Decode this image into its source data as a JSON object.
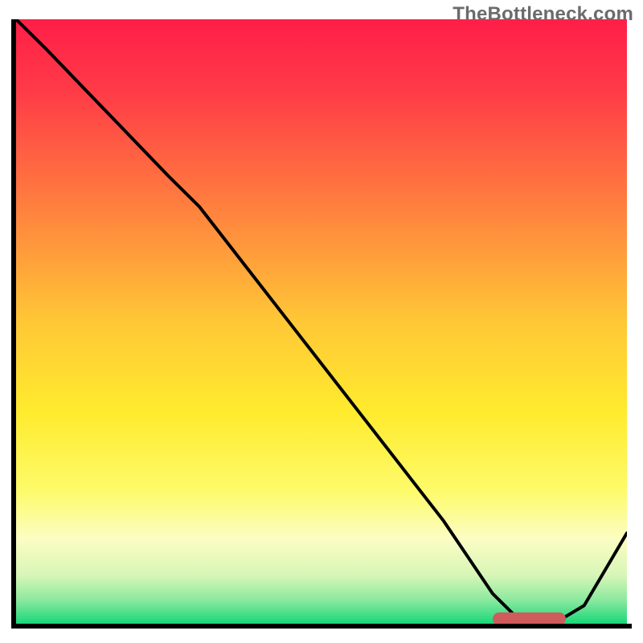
{
  "attribution": "TheBottleneck.com",
  "chart_data": {
    "type": "line",
    "title": "",
    "xlabel": "",
    "ylabel": "",
    "xlim": [
      0,
      100
    ],
    "ylim": [
      0,
      100
    ],
    "series": [
      {
        "name": "curve",
        "x": [
          0,
          5,
          25,
          30,
          40,
          50,
          60,
          70,
          78,
          82,
          88,
          93,
          100
        ],
        "values": [
          100,
          95,
          74,
          69,
          56,
          43,
          30,
          17,
          5,
          1,
          0,
          3,
          15
        ]
      }
    ],
    "marker": {
      "x_start": 78,
      "x_end": 90,
      "y": 0
    },
    "background_gradient": {
      "stops": [
        {
          "pct": 0,
          "color": "#FF1E48"
        },
        {
          "pct": 12,
          "color": "#FF3B47"
        },
        {
          "pct": 30,
          "color": "#FF7C3F"
        },
        {
          "pct": 50,
          "color": "#FFC736"
        },
        {
          "pct": 65,
          "color": "#FFEB2E"
        },
        {
          "pct": 78,
          "color": "#FDFB6A"
        },
        {
          "pct": 86,
          "color": "#FCFDC3"
        },
        {
          "pct": 92,
          "color": "#D7F6B7"
        },
        {
          "pct": 96,
          "color": "#8DE9A0"
        },
        {
          "pct": 100,
          "color": "#19D77A"
        }
      ]
    }
  },
  "colors": {
    "line": "#000000",
    "marker": "#CF5B5D",
    "attribution_text": "#6b6b6b"
  }
}
